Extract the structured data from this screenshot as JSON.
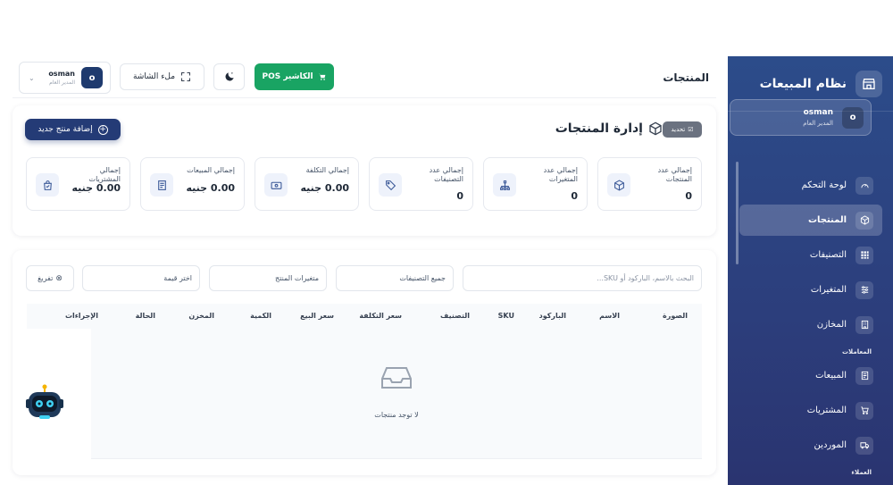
{
  "sidebar": {
    "app_title": "نظام المبيعات",
    "user": {
      "initial": "o",
      "name": "osman",
      "role": "المدير العام"
    },
    "items": [
      {
        "label": "لوحة التحكم",
        "icon": "dashboard-icon"
      },
      {
        "label": "المنتجات",
        "icon": "box-icon",
        "active": true
      },
      {
        "label": "التصنيفات",
        "icon": "grid-icon"
      },
      {
        "label": "المتغيرات",
        "icon": "sliders-icon"
      },
      {
        "label": "المخازن",
        "icon": "building-icon"
      }
    ],
    "section_transactions": "المعاملات",
    "transactions": [
      {
        "label": "المبيعات",
        "icon": "receipt-icon"
      },
      {
        "label": "المشتريات",
        "icon": "cart-icon"
      },
      {
        "label": "الموردين",
        "icon": "truck-icon"
      }
    ],
    "section_customers": "العملاء"
  },
  "topbar": {
    "page_title": "المنتجات",
    "pos_label": "الكاشير POS",
    "fullscreen_label": "ملء الشاشة",
    "user": {
      "initial": "o",
      "name": "osman",
      "role": "المدير العام"
    }
  },
  "products": {
    "title": "إدارة المنتجات",
    "update_badge": "تحديد",
    "add_button": "إضافة منتج جديد",
    "stats": [
      {
        "label": "إجمالي عدد المنتجات",
        "value": "0"
      },
      {
        "label": "إجمالي عدد المتغيرات",
        "value": "0"
      },
      {
        "label": "إجمالي عدد التصنيفات",
        "value": "0"
      },
      {
        "label": "إجمالي التكلفة",
        "value": "0.00 جنيه"
      },
      {
        "label": "إجمالي المبيعات",
        "value": "0.00 جنيه"
      },
      {
        "label": "إجمالي المشتريات",
        "value": "0.00 جنيه"
      }
    ]
  },
  "filters": {
    "search_placeholder": "البحث بالاسم، الباركود أو SKU...",
    "category": "جميع التصنيفات",
    "variants": "متغيرات المنتج",
    "value": "اختر قيمة",
    "clear": "تفريغ"
  },
  "table": {
    "columns": [
      "الصورة",
      "الاسم",
      "الباركود",
      "SKU",
      "التصنيف",
      "سعر التكلفة",
      "سعر البيع",
      "الكمية",
      "المخزن",
      "الحالة",
      "الإجراءات"
    ],
    "empty_text": "لا توجد منتجات"
  },
  "colors": {
    "primary": "#243b76",
    "pos_green": "#19a463",
    "sidebar": "#2c4c8a"
  }
}
